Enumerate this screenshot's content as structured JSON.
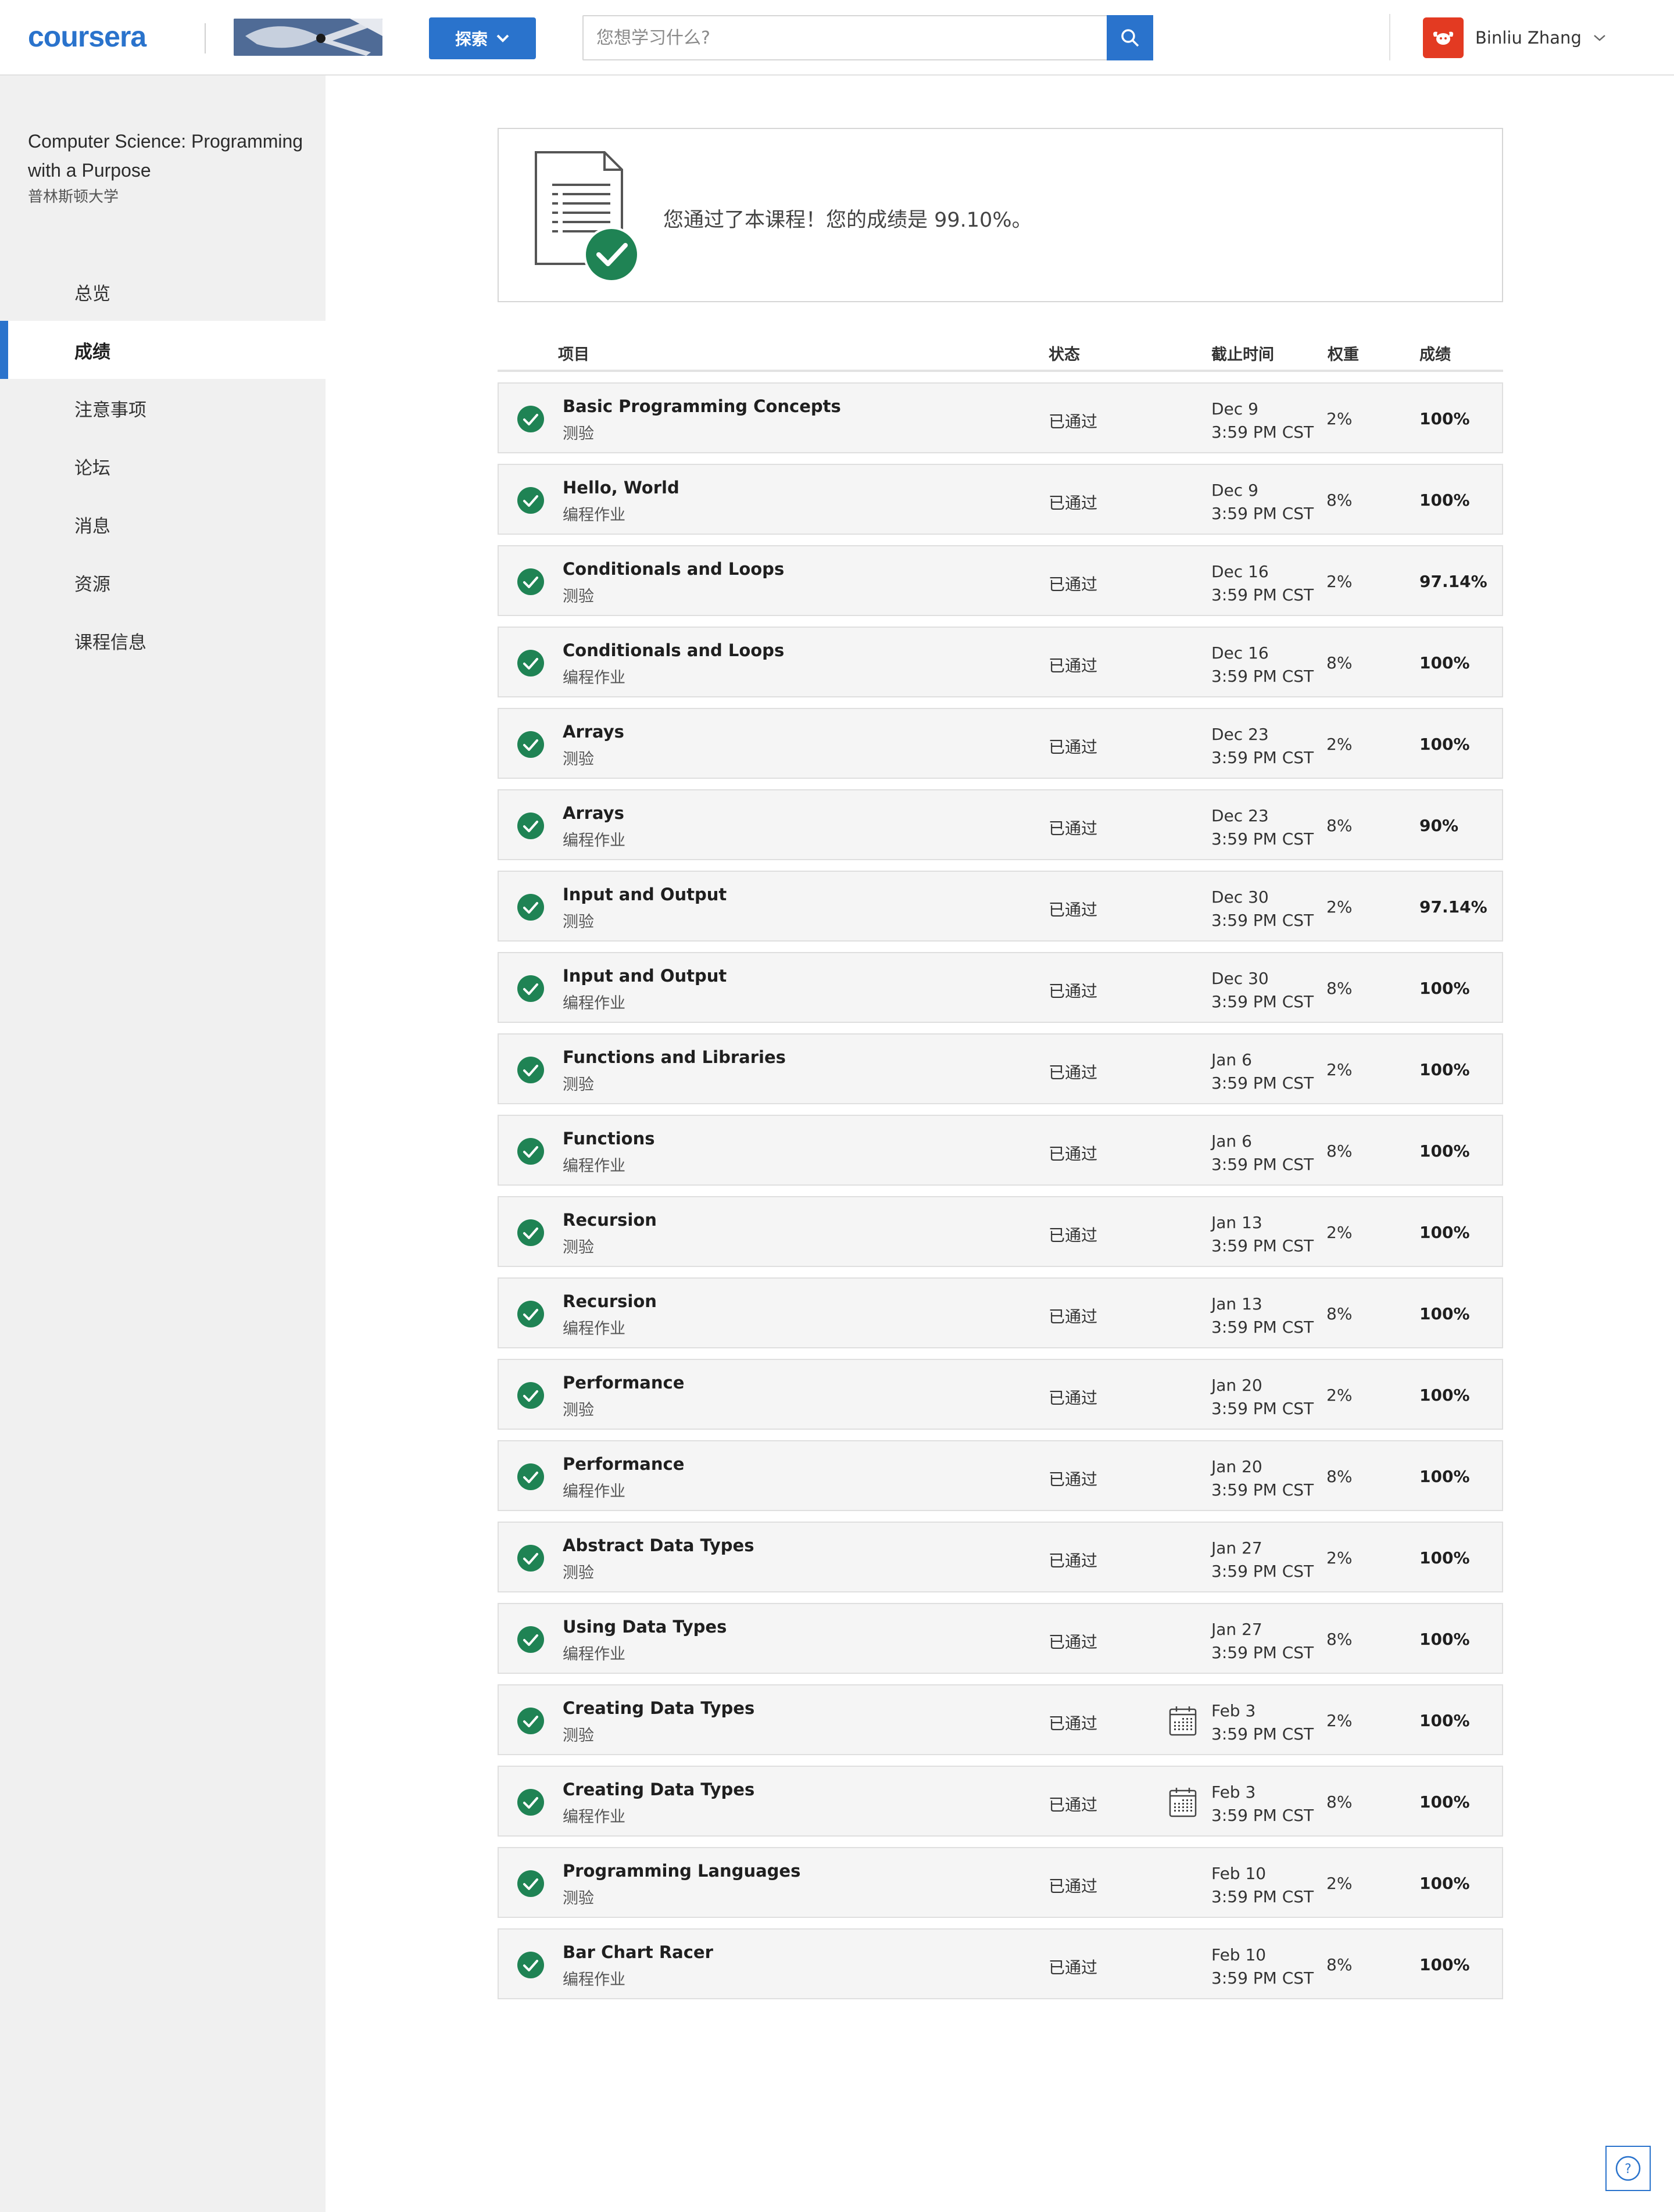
{
  "header": {
    "logo_text": "coursera",
    "explore_label": "探索",
    "search_placeholder": "您想学习什么?",
    "user_name": "Binliu Zhang"
  },
  "sidebar": {
    "course_title": "Computer Science: Programming with a Purpose",
    "university": "普林斯顿大学",
    "items": [
      {
        "label": "总览",
        "active": false
      },
      {
        "label": "成绩",
        "active": true
      },
      {
        "label": "注意事项",
        "active": false
      },
      {
        "label": "论坛",
        "active": false
      },
      {
        "label": "消息",
        "active": false
      },
      {
        "label": "资源",
        "active": false
      },
      {
        "label": "课程信息",
        "active": false
      }
    ]
  },
  "summary": {
    "message": "您通过了本课程！您的成绩是 99.10%。"
  },
  "table": {
    "headers": {
      "item": "项目",
      "status": "状态",
      "due": "截止时间",
      "weight": "权重",
      "grade": "成绩"
    },
    "rows": [
      {
        "name": "Basic Programming Concepts",
        "type": "测验",
        "status": "已通过",
        "date": "Dec 9",
        "time": "3:59 PM CST",
        "weight": "2%",
        "grade": "100%",
        "calendar": false
      },
      {
        "name": "Hello, World",
        "type": "编程作业",
        "status": "已通过",
        "date": "Dec 9",
        "time": "3:59 PM CST",
        "weight": "8%",
        "grade": "100%",
        "calendar": false
      },
      {
        "name": "Conditionals and Loops",
        "type": "测验",
        "status": "已通过",
        "date": "Dec 16",
        "time": "3:59 PM CST",
        "weight": "2%",
        "grade": "97.14%",
        "calendar": false
      },
      {
        "name": "Conditionals and Loops",
        "type": "编程作业",
        "status": "已通过",
        "date": "Dec 16",
        "time": "3:59 PM CST",
        "weight": "8%",
        "grade": "100%",
        "calendar": false
      },
      {
        "name": "Arrays",
        "type": "测验",
        "status": "已通过",
        "date": "Dec 23",
        "time": "3:59 PM CST",
        "weight": "2%",
        "grade": "100%",
        "calendar": false
      },
      {
        "name": "Arrays",
        "type": "编程作业",
        "status": "已通过",
        "date": "Dec 23",
        "time": "3:59 PM CST",
        "weight": "8%",
        "grade": "90%",
        "calendar": false
      },
      {
        "name": "Input and Output",
        "type": "测验",
        "status": "已通过",
        "date": "Dec 30",
        "time": "3:59 PM CST",
        "weight": "2%",
        "grade": "97.14%",
        "calendar": false
      },
      {
        "name": "Input and Output",
        "type": "编程作业",
        "status": "已通过",
        "date": "Dec 30",
        "time": "3:59 PM CST",
        "weight": "8%",
        "grade": "100%",
        "calendar": false
      },
      {
        "name": "Functions and Libraries",
        "type": "测验",
        "status": "已通过",
        "date": "Jan 6",
        "time": "3:59 PM CST",
        "weight": "2%",
        "grade": "100%",
        "calendar": false
      },
      {
        "name": "Functions",
        "type": "编程作业",
        "status": "已通过",
        "date": "Jan 6",
        "time": "3:59 PM CST",
        "weight": "8%",
        "grade": "100%",
        "calendar": false
      },
      {
        "name": "Recursion",
        "type": "测验",
        "status": "已通过",
        "date": "Jan 13",
        "time": "3:59 PM CST",
        "weight": "2%",
        "grade": "100%",
        "calendar": false
      },
      {
        "name": "Recursion",
        "type": "编程作业",
        "status": "已通过",
        "date": "Jan 13",
        "time": "3:59 PM CST",
        "weight": "8%",
        "grade": "100%",
        "calendar": false
      },
      {
        "name": "Performance",
        "type": "测验",
        "status": "已通过",
        "date": "Jan 20",
        "time": "3:59 PM CST",
        "weight": "2%",
        "grade": "100%",
        "calendar": false
      },
      {
        "name": "Performance",
        "type": "编程作业",
        "status": "已通过",
        "date": "Jan 20",
        "time": "3:59 PM CST",
        "weight": "8%",
        "grade": "100%",
        "calendar": false
      },
      {
        "name": "Abstract Data Types",
        "type": "测验",
        "status": "已通过",
        "date": "Jan 27",
        "time": "3:59 PM CST",
        "weight": "2%",
        "grade": "100%",
        "calendar": false
      },
      {
        "name": "Using Data Types",
        "type": "编程作业",
        "status": "已通过",
        "date": "Jan 27",
        "time": "3:59 PM CST",
        "weight": "8%",
        "grade": "100%",
        "calendar": false
      },
      {
        "name": "Creating Data Types",
        "type": "测验",
        "status": "已通过",
        "date": "Feb 3",
        "time": "3:59 PM CST",
        "weight": "2%",
        "grade": "100%",
        "calendar": true
      },
      {
        "name": "Creating Data Types",
        "type": "编程作业",
        "status": "已通过",
        "date": "Feb 3",
        "time": "3:59 PM CST",
        "weight": "8%",
        "grade": "100%",
        "calendar": true
      },
      {
        "name": "Programming Languages",
        "type": "测验",
        "status": "已通过",
        "date": "Feb 10",
        "time": "3:59 PM CST",
        "weight": "2%",
        "grade": "100%",
        "calendar": false
      },
      {
        "name": "Bar Chart Racer",
        "type": "编程作业",
        "status": "已通过",
        "date": "Feb 10",
        "time": "3:59 PM CST",
        "weight": "8%",
        "grade": "100%",
        "calendar": false
      }
    ]
  },
  "icons": {
    "check": "check-circle-icon",
    "calendar": "calendar-icon",
    "search": "search-icon",
    "help": "help-icon"
  },
  "colors": {
    "brand": "#2a73cc",
    "success": "#1f8354",
    "avatar": "#e33a22"
  }
}
